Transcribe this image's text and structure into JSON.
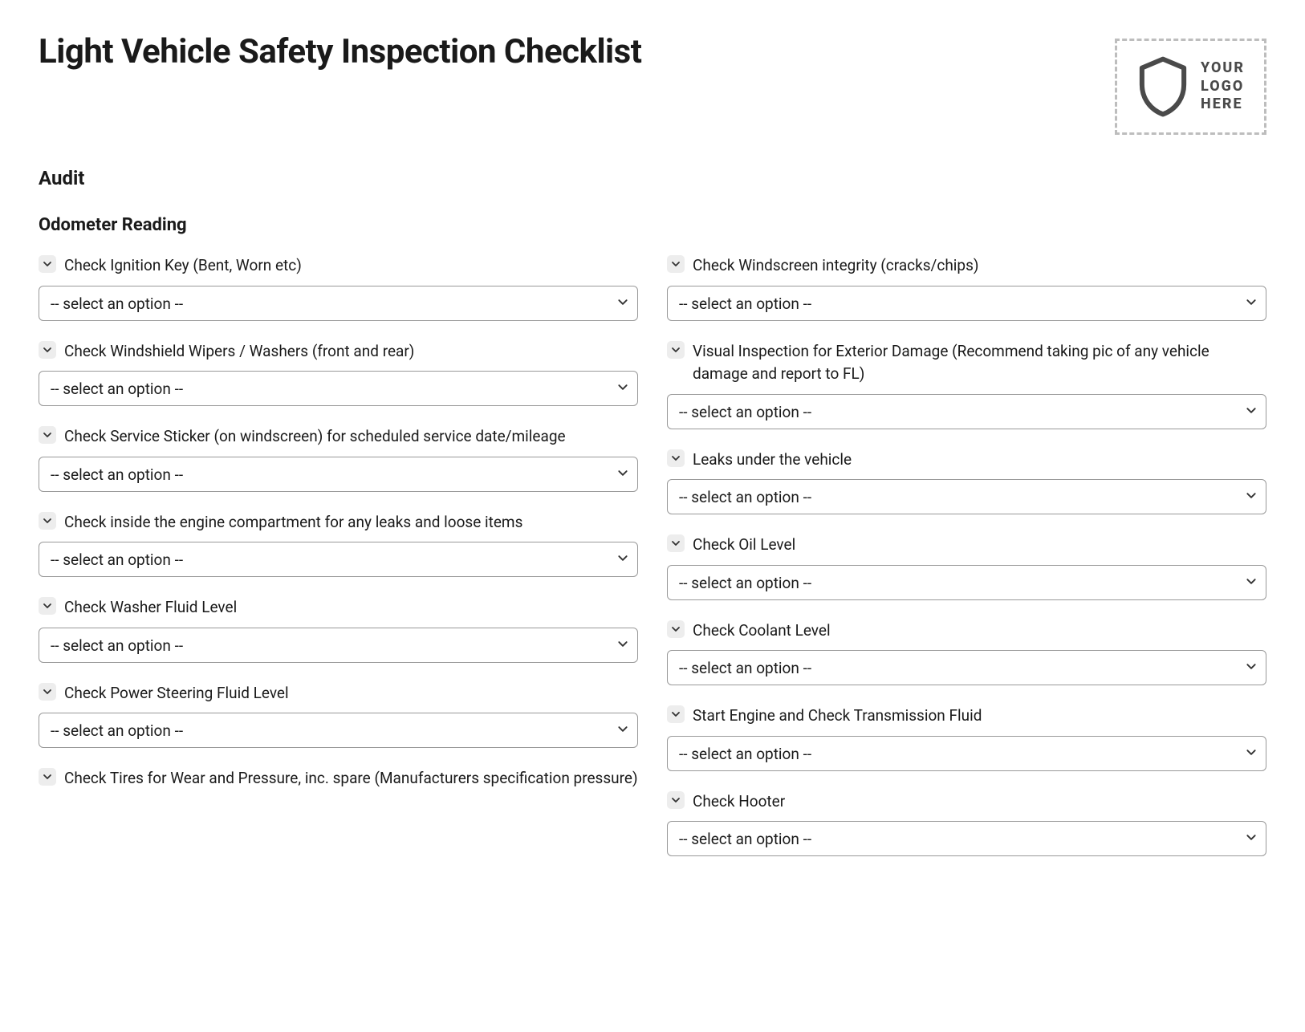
{
  "title": "Light Vehicle Safety Inspection Checklist",
  "logo": {
    "line1": "YOUR",
    "line2": "LOGO",
    "line3": "HERE"
  },
  "section": "Audit",
  "subsection": "Odometer Reading",
  "placeholder": "-- select an option --",
  "left_items": [
    "Check Ignition Key (Bent, Worn etc)",
    "Check Windshield Wipers / Washers (front and rear)",
    "Check Service Sticker (on windscreen) for scheduled service date/mileage",
    "Check inside the engine compartment for any leaks and loose items",
    "Check Washer Fluid Level",
    "Check Power Steering Fluid Level",
    "Check Tires for Wear and Pressure, inc. spare (Manufacturers specification pressure)"
  ],
  "right_items": [
    "Check Windscreen integrity (cracks/chips)",
    "Visual Inspection for Exterior Damage (Recommend taking pic of any vehicle damage and report to FL)",
    "Leaks under the vehicle",
    "Check Oil Level",
    "Check Coolant Level",
    "Start Engine and Check Transmission Fluid",
    "Check Hooter"
  ]
}
